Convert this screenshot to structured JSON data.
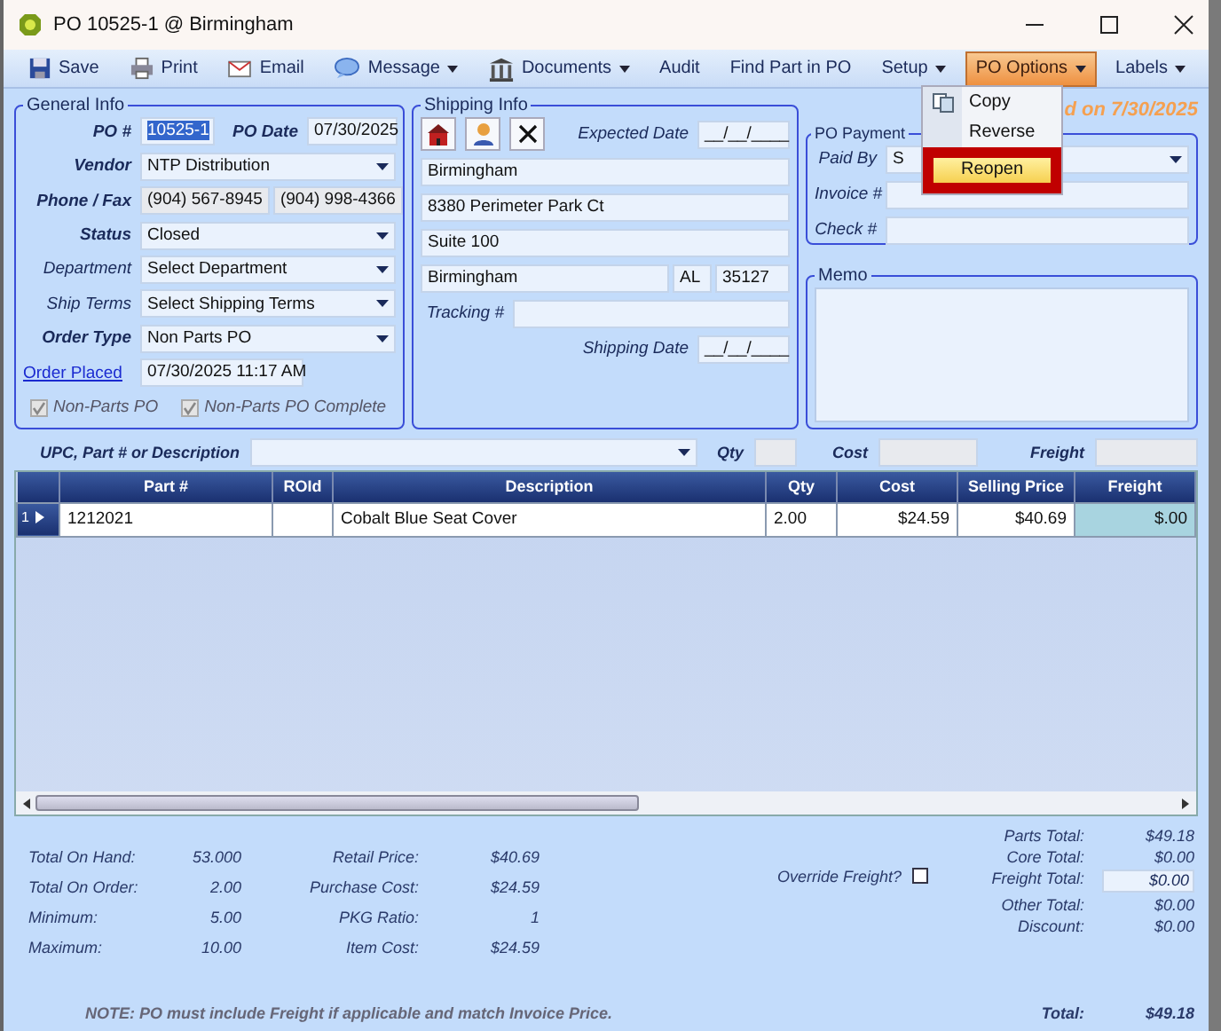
{
  "window": {
    "title": "PO 10525-1 @ Birmingham"
  },
  "toolbar": [
    {
      "label": "Save",
      "dropdown": false,
      "selected": false
    },
    {
      "label": "Print",
      "dropdown": false,
      "selected": false
    },
    {
      "label": "Email",
      "dropdown": false,
      "selected": false
    },
    {
      "label": "Message",
      "dropdown": true,
      "selected": false
    },
    {
      "label": "Documents",
      "dropdown": true,
      "selected": false
    },
    {
      "label": "Audit",
      "dropdown": false,
      "selected": false
    },
    {
      "label": "Find Part in PO",
      "dropdown": false,
      "selected": false
    },
    {
      "label": "Setup",
      "dropdown": true,
      "selected": false
    },
    {
      "label": "PO Options",
      "dropdown": true,
      "selected": true
    },
    {
      "label": "Labels",
      "dropdown": true,
      "selected": false
    }
  ],
  "po_options_menu": [
    {
      "label": "Copy",
      "highlighted": false
    },
    {
      "label": "Reverse",
      "highlighted": false
    },
    {
      "label": "Reopen",
      "highlighted": true
    }
  ],
  "status_banner": "d on 7/30/2025",
  "general_info": {
    "title": "General Info",
    "po_number_label": "PO #",
    "po_number": "10525-1",
    "po_date_label": "PO Date",
    "po_date": "07/30/2025",
    "vendor_label": "Vendor",
    "vendor": "NTP Distribution",
    "phone_fax_label": "Phone / Fax",
    "phone": "(904) 567-8945",
    "fax": "(904) 998-4366",
    "status_label": "Status",
    "status": "Closed",
    "department_label": "Department",
    "department": "Select Department",
    "ship_terms_label": "Ship Terms",
    "ship_terms": "Select Shipping Terms",
    "order_type_label": "Order Type",
    "order_type": "Non Parts PO",
    "order_placed_link": "Order Placed",
    "order_placed": "07/30/2025 11:17 AM",
    "checkboxes": [
      {
        "label": "Non-Parts PO",
        "checked": true,
        "disabled": true
      },
      {
        "label": "Non-Parts PO Complete",
        "checked": true,
        "disabled": true
      }
    ]
  },
  "shipping_info": {
    "title": "Shipping Info",
    "expected_date_label": "Expected Date",
    "expected_date": "__/__/____",
    "name": "Birmingham",
    "street": "8380 Perimeter Park Ct",
    "suite": "Suite 100",
    "city": "Birmingham",
    "state": "AL",
    "zip": "35127",
    "tracking_label": "Tracking #",
    "shipping_date_label": "Shipping Date",
    "shipping_date": "__/__/____"
  },
  "po_payment": {
    "title": "PO Payment",
    "paid_by_label": "Paid By",
    "paid_by": "S",
    "invoice_label": "Invoice #",
    "check_label": "Check #"
  },
  "memo": {
    "title": "Memo"
  },
  "part_search": {
    "label": "UPC, Part # or Description",
    "qty_label": "Qty",
    "cost_label": "Cost",
    "freight_label": "Freight"
  },
  "table": {
    "columns": [
      "Part #",
      "ROId",
      "Description",
      "Qty",
      "Cost",
      "Selling Price",
      "Freight"
    ],
    "rows": [
      {
        "number": "1",
        "selected": true,
        "cells": [
          "1212021",
          "",
          "Cobalt Blue Seat Cover",
          "2.00",
          "$24.59",
          "$40.69",
          "$.00"
        ]
      }
    ]
  },
  "stats": [
    {
      "label": "Total On Hand:",
      "value": "53.000",
      "label2": "Retail Price:",
      "value2": "$40.69"
    },
    {
      "label": "Total On Order:",
      "value": "2.00",
      "label2": "Purchase Cost:",
      "value2": "$24.59"
    },
    {
      "label": "Minimum:",
      "value": "5.00",
      "label2": "PKG Ratio:",
      "value2": "1"
    },
    {
      "label": "Maximum:",
      "value": "10.00",
      "label2": "Item Cost:",
      "value2": "$24.59"
    }
  ],
  "override_freight": {
    "label": "Override Freight?",
    "checked": false
  },
  "totals": [
    {
      "label": "Parts Total:",
      "value": "$49.18",
      "kind": "text"
    },
    {
      "label": "Core Total:",
      "value": "$0.00",
      "kind": "text"
    },
    {
      "label": "Freight Total:",
      "value": "$0.00",
      "kind": "field"
    },
    {
      "label": "Other Total:",
      "value": "$0.00",
      "kind": "text"
    },
    {
      "label": "Discount:",
      "value": "$0.00",
      "kind": "text"
    }
  ],
  "grand_total": {
    "label": "Total:",
    "value": "$49.18"
  },
  "note": "NOTE: PO must include Freight if applicable and match Invoice Price."
}
